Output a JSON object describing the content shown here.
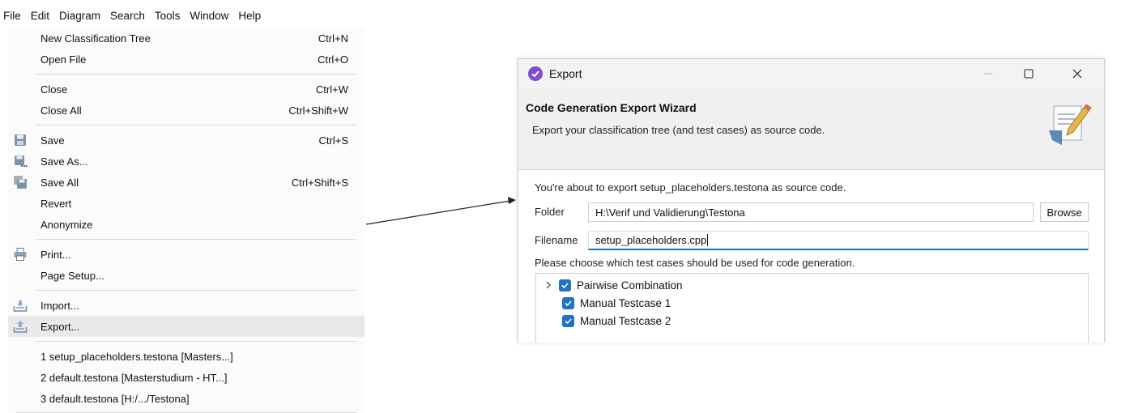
{
  "menubar": [
    "File",
    "Edit",
    "Diagram",
    "Search",
    "Tools",
    "Window",
    "Help"
  ],
  "file_menu": {
    "groups": [
      [
        {
          "label": "New Classification Tree",
          "shortcut": "Ctrl+N",
          "icon": ""
        },
        {
          "label": "Open File",
          "shortcut": "Ctrl+O",
          "icon": ""
        }
      ],
      [
        {
          "label": "Close",
          "shortcut": "Ctrl+W",
          "icon": ""
        },
        {
          "label": "Close All",
          "shortcut": "Ctrl+Shift+W",
          "icon": ""
        }
      ],
      [
        {
          "label": "Save",
          "shortcut": "Ctrl+S",
          "icon": "save-icon"
        },
        {
          "label": "Save As...",
          "shortcut": "",
          "icon": "save-as-icon"
        },
        {
          "label": "Save All",
          "shortcut": "Ctrl+Shift+S",
          "icon": "save-all-icon"
        },
        {
          "label": "Revert",
          "shortcut": "",
          "icon": ""
        },
        {
          "label": "Anonymize",
          "shortcut": "",
          "icon": ""
        }
      ],
      [
        {
          "label": "Print...",
          "shortcut": "",
          "icon": "print-icon"
        },
        {
          "label": "Page Setup...",
          "shortcut": "",
          "icon": ""
        }
      ],
      [
        {
          "label": "Import...",
          "shortcut": "",
          "icon": "import-icon"
        },
        {
          "label": "Export...",
          "shortcut": "",
          "icon": "export-icon",
          "highlighted": true
        }
      ],
      [
        {
          "label": "1 setup_placeholders.testona  [Masters...]",
          "shortcut": "",
          "icon": ""
        },
        {
          "label": "2 default.testona  [Masterstudium - HT...]",
          "shortcut": "",
          "icon": ""
        },
        {
          "label": "3 default.testona  [H:/.../Testona]",
          "shortcut": "",
          "icon": ""
        }
      ]
    ]
  },
  "dialog": {
    "title": "Export",
    "banner_title": "Code Generation Export Wizard",
    "banner_subtitle": "Export your classification tree (and test cases) as source code.",
    "intro": "You're about to export setup_placeholders.testona as source code.",
    "folder_label": "Folder",
    "folder_value": "H:\\Verif und Validierung\\Testona",
    "browse_label": "Browse",
    "filename_label": "Filename",
    "filename_value": "setup_placeholders.cpp",
    "choose_label": "Please choose which test cases should be used for code generation.",
    "tree": [
      {
        "label": "Pairwise Combination",
        "checked": true,
        "expandable": true,
        "depth": 0
      },
      {
        "label": "Manual Testcase 1",
        "checked": true,
        "expandable": false,
        "depth": 1
      },
      {
        "label": "Manual Testcase 2",
        "checked": true,
        "expandable": false,
        "depth": 1
      }
    ]
  },
  "colors": {
    "accent": "#1f72c4",
    "menu_highlight": "#e9e9e9",
    "banner_bg": "#f0f0f0",
    "app_icon": "#7b4fd0"
  }
}
